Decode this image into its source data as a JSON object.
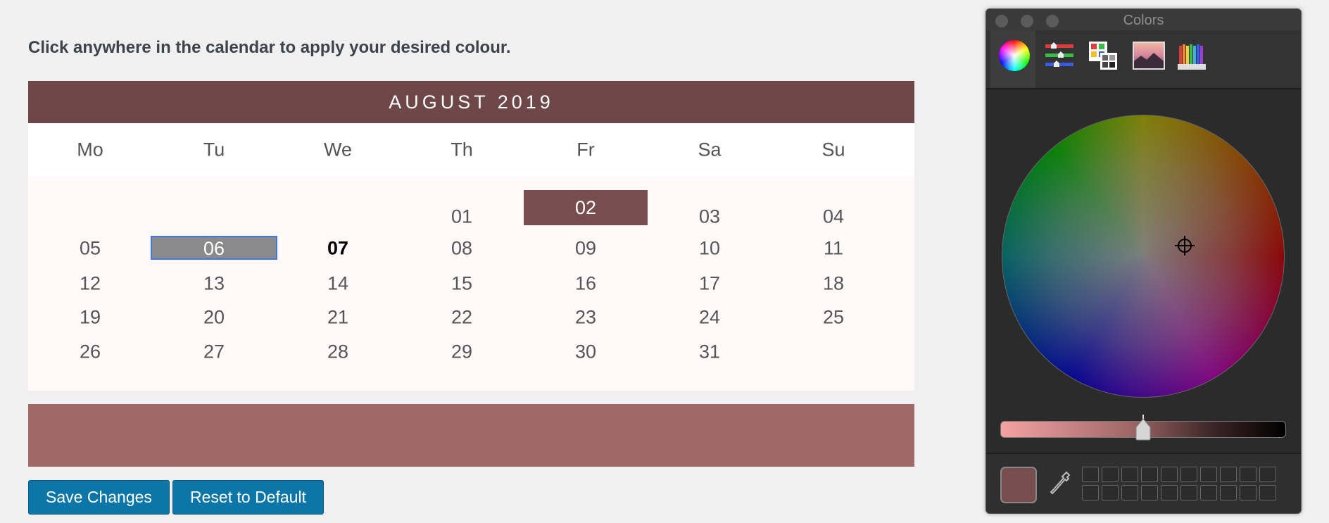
{
  "instruction": "Click anywhere in the calendar to apply your desired colour.",
  "calendar": {
    "title": "AUGUST 2019",
    "weekdays": [
      "Mo",
      "Tu",
      "We",
      "Th",
      "Fr",
      "Sa",
      "Su"
    ],
    "weeks": [
      [
        "",
        "",
        "",
        "01",
        "02",
        "03",
        "04"
      ],
      [
        "05",
        "06",
        "07",
        "08",
        "09",
        "10",
        "11"
      ],
      [
        "12",
        "13",
        "14",
        "15",
        "16",
        "17",
        "18"
      ],
      [
        "19",
        "20",
        "21",
        "22",
        "23",
        "24",
        "25"
      ],
      [
        "26",
        "27",
        "28",
        "29",
        "30",
        "31",
        ""
      ]
    ],
    "selected_day": "02",
    "focused_day": "06",
    "today": "07",
    "header_color": "#6e4848",
    "selected_color": "#774d4d"
  },
  "preview": {
    "color": "#a06868"
  },
  "buttons": {
    "save_label": "Save Changes",
    "reset_label": "Reset to Default"
  },
  "color_panel": {
    "title": "Colors",
    "tools": [
      "color-wheel-icon",
      "color-sliders-icon",
      "color-palettes-icon",
      "image-palettes-icon",
      "pencils-icon"
    ],
    "active_tool": "color-wheel-icon",
    "current_color": "#774d4d",
    "swatch_rows": 2,
    "swatch_cols": 10
  }
}
